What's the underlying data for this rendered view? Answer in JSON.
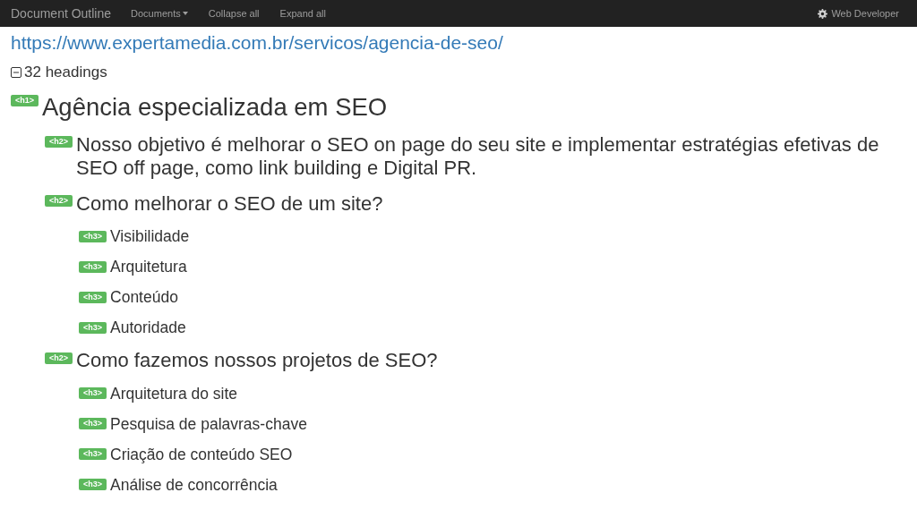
{
  "navbar": {
    "brand": "Document Outline",
    "menu": [
      {
        "label": "Documents",
        "dropdown": true
      },
      {
        "label": "Collapse all",
        "dropdown": false
      },
      {
        "label": "Expand all",
        "dropdown": false
      }
    ],
    "tool": "Web Developer"
  },
  "url": "https://www.expertamedia.com.br/servicos/agencia-de-seo/",
  "summary": {
    "label": "32 headings",
    "expanded": true
  },
  "headings": [
    {
      "tag": "<h1>",
      "text": "Agência especializada em SEO",
      "children": [
        {
          "tag": "<h2>",
          "text": "Nosso objetivo é melhorar o SEO on page do seu site e implementar estratégias efetivas de SEO off page, como link building e Digital PR."
        },
        {
          "tag": "<h2>",
          "text": "Como melhorar o SEO de um site?",
          "children": [
            {
              "tag": "<h3>",
              "text": "Visibilidade"
            },
            {
              "tag": "<h3>",
              "text": "Arquitetura"
            },
            {
              "tag": "<h3>",
              "text": "Conteúdo"
            },
            {
              "tag": "<h3>",
              "text": "Autoridade"
            }
          ]
        },
        {
          "tag": "<h2>",
          "text": "Como fazemos nossos projetos de SEO?",
          "children": [
            {
              "tag": "<h3>",
              "text": "Arquitetura do site"
            },
            {
              "tag": "<h3>",
              "text": "Pesquisa de palavras-chave"
            },
            {
              "tag": "<h3>",
              "text": "Criação de conteúdo SEO"
            },
            {
              "tag": "<h3>",
              "text": "Análise de concorrência"
            }
          ]
        }
      ]
    }
  ]
}
